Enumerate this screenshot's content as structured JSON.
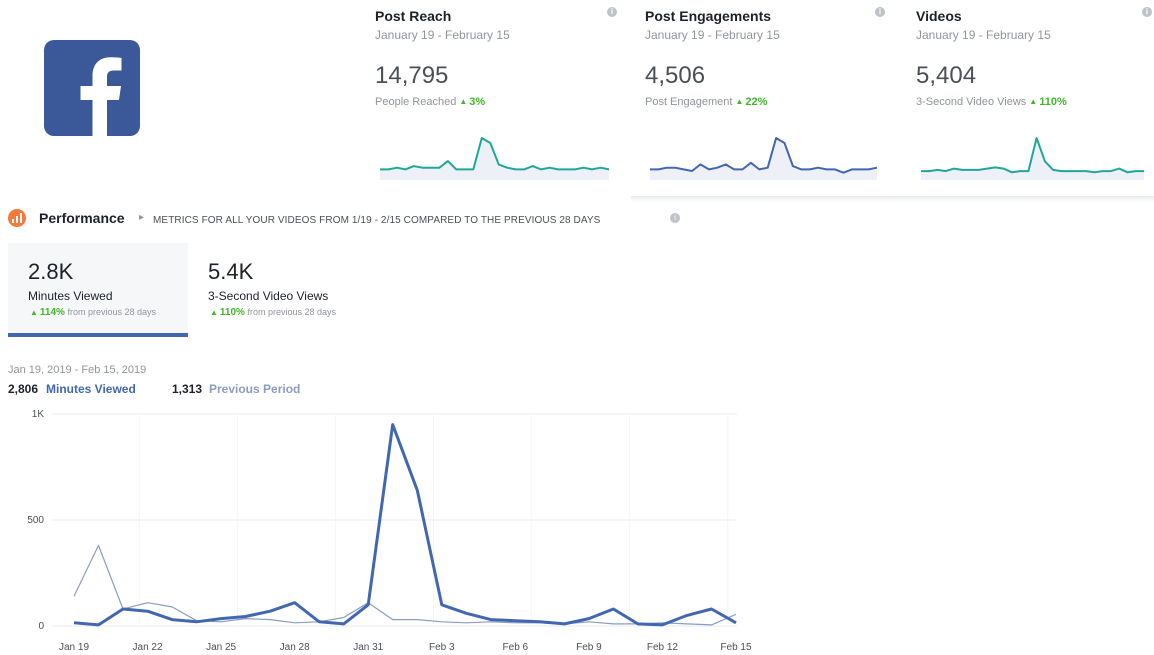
{
  "logo": {
    "name": "facebook-logo",
    "color": "#3b5998"
  },
  "cards": [
    {
      "title": "Post Reach",
      "date_range": "January 19 - February 15",
      "value": "14,795",
      "metric_label": "People Reached",
      "change": "3%",
      "spark": [
        4,
        4,
        5,
        4,
        6,
        5,
        5,
        5,
        9,
        4,
        4,
        4,
        23,
        20,
        7,
        5,
        4,
        4,
        6,
        4,
        5,
        4,
        4,
        4,
        5,
        4,
        5,
        4
      ]
    },
    {
      "title": "Post Engagements",
      "date_range": "January 19 - February 15",
      "value": "4,506",
      "metric_label": "Post Engagement",
      "change": "22%",
      "spark": [
        4,
        4,
        5,
        5,
        4,
        3,
        7,
        4,
        5,
        7,
        4,
        4,
        8,
        4,
        5,
        23,
        20,
        6,
        4,
        4,
        5,
        4,
        4,
        2,
        4,
        4,
        4,
        5
      ]
    },
    {
      "title": "Videos",
      "date_range": "January 19 - February 15",
      "value": "5,404",
      "metric_label": "3-Second Video Views",
      "change": "110%",
      "spark": [
        4,
        4,
        5,
        4,
        6,
        5,
        5,
        5,
        6,
        7,
        6,
        3,
        4,
        4,
        31,
        12,
        5,
        4,
        4,
        4,
        4,
        3,
        4,
        4,
        6,
        3,
        4,
        4
      ]
    }
  ],
  "performance": {
    "title": "Performance",
    "description": "METRICS FOR ALL YOUR VIDEOS FROM 1/19 - 2/15 COMPARED TO THE PREVIOUS 28 DAYS"
  },
  "tabs": [
    {
      "value": "2.8K",
      "label": "Minutes Viewed",
      "change": "114%",
      "change_suffix": "from previous 28 days",
      "selected": true
    },
    {
      "value": "5.4K",
      "label": "3-Second Video Views",
      "change": "110%",
      "change_suffix": "from previous 28 days",
      "selected": false
    }
  ],
  "chart_header": {
    "date_range": "Jan 19, 2019 - Feb 15, 2019",
    "series_a_total": "2,806",
    "series_a_label": "Minutes Viewed",
    "series_b_total": "1,313",
    "series_b_label": "Previous Period"
  },
  "chart_data": {
    "type": "line",
    "x": [
      "Jan 19",
      "Jan 20",
      "Jan 21",
      "Jan 22",
      "Jan 23",
      "Jan 24",
      "Jan 25",
      "Jan 26",
      "Jan 27",
      "Jan 28",
      "Jan 29",
      "Jan 30",
      "Jan 31",
      "Feb 1",
      "Feb 2",
      "Feb 3",
      "Feb 4",
      "Feb 5",
      "Feb 6",
      "Feb 7",
      "Feb 8",
      "Feb 9",
      "Feb 10",
      "Feb 11",
      "Feb 12",
      "Feb 13",
      "Feb 14",
      "Feb 15"
    ],
    "x_tick_labels": [
      "Jan 19",
      "Jan 22",
      "Jan 25",
      "Jan 28",
      "Jan 31",
      "Feb 3",
      "Feb 6",
      "Feb 9",
      "Feb 12",
      "Feb 15"
    ],
    "y_tick_labels": [
      "0",
      "500",
      "1K"
    ],
    "ylim": [
      0,
      1000
    ],
    "series": [
      {
        "name": "Minutes Viewed",
        "color": "#4267b2",
        "values": [
          15,
          5,
          80,
          70,
          30,
          20,
          35,
          45,
          70,
          110,
          20,
          10,
          100,
          950,
          640,
          100,
          60,
          30,
          25,
          20,
          10,
          35,
          80,
          10,
          5,
          50,
          80,
          15
        ]
      },
      {
        "name": "Previous Period",
        "color": "#8b9dc3",
        "values": [
          140,
          380,
          80,
          110,
          90,
          25,
          20,
          35,
          30,
          15,
          20,
          40,
          110,
          30,
          30,
          20,
          15,
          20,
          15,
          15,
          10,
          20,
          10,
          10,
          15,
          10,
          5,
          55
        ]
      }
    ],
    "grid": true
  }
}
